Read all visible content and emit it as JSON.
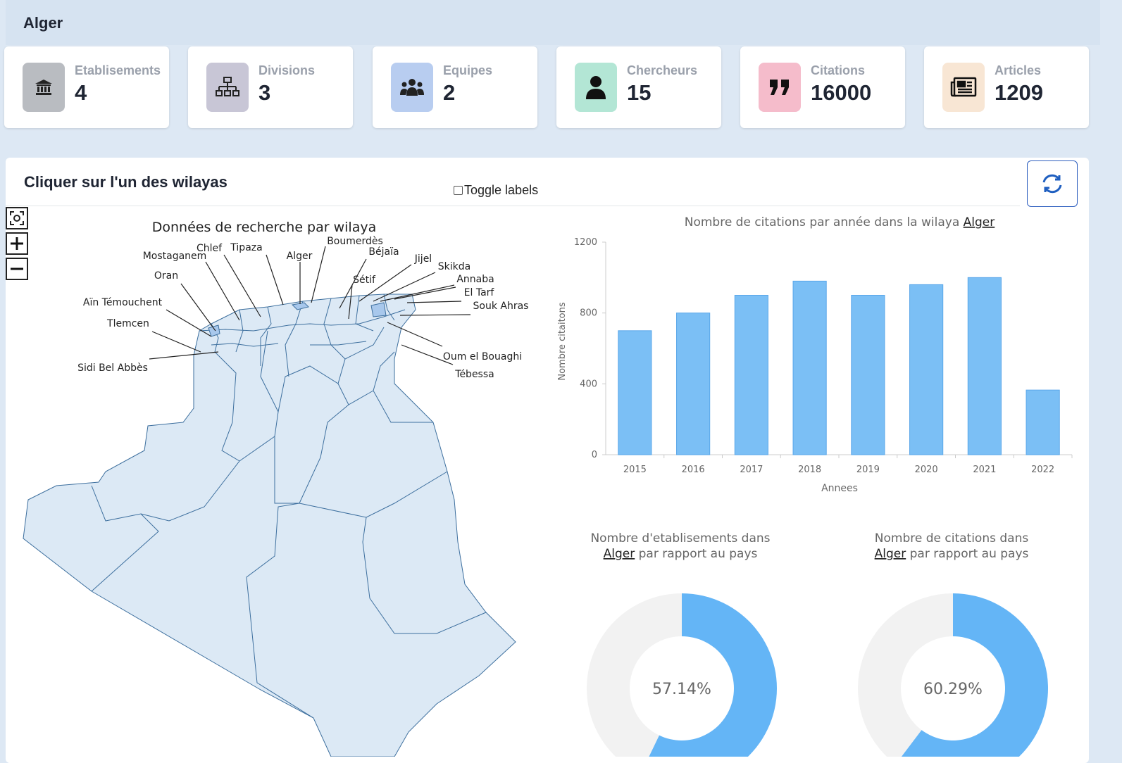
{
  "header": {
    "title": "Alger"
  },
  "stats": [
    {
      "label": "Etablisements",
      "value": "4",
      "icon": "bank-icon",
      "color": "#b9bcc1"
    },
    {
      "label": "Divisions",
      "value": "3",
      "icon": "hierarchy-icon",
      "color": "#c8c6d6"
    },
    {
      "label": "Equipes",
      "value": "2",
      "icon": "team-icon",
      "color": "#b8cdf0"
    },
    {
      "label": "Chercheurs",
      "value": "15",
      "icon": "user-icon",
      "color": "#b3e6d5"
    },
    {
      "label": "Citations",
      "value": "16000",
      "icon": "quote-icon",
      "color": "#f5bccb"
    },
    {
      "label": "Articles",
      "value": "1209",
      "icon": "newspaper-icon",
      "color": "#f8e6d4"
    }
  ],
  "panel": {
    "title": "Cliquer sur l'un des wilayas",
    "toggle_label": "Toggle labels"
  },
  "map": {
    "title": "Données de recherche par wilaya",
    "labels": [
      "Mostaganem",
      "Chlef",
      "Tipaza",
      "Alger",
      "Boumerdès",
      "Béjaïa",
      "Jijel",
      "Skikda",
      "Annaba",
      "El Tarf",
      "Souk Ahras",
      "Oran",
      "Aïn Témouchent",
      "Tlemcen",
      "Sidi Bel Abbès",
      "Sétif",
      "Oum el Bouaghi",
      "Tébessa"
    ]
  },
  "chart_data": [
    {
      "type": "bar",
      "title": "Nombre de citations par année dans la wilaya",
      "title_link": "Alger",
      "categories": [
        "2015",
        "2016",
        "2017",
        "2018",
        "2019",
        "2020",
        "2021",
        "2022"
      ],
      "values": [
        700,
        800,
        900,
        980,
        900,
        960,
        1000,
        365
      ],
      "xlabel": "Annees",
      "ylabel": "Nombre citaitons",
      "ylim": [
        0,
        1200
      ],
      "yticks": [
        0,
        400,
        800,
        1200
      ],
      "color": "#7bbff5"
    },
    {
      "type": "pie",
      "title_line1": "Nombre d'etablisements dans",
      "title_link": "Alger",
      "title_rest": "par rapport au pays",
      "percent": 57.14,
      "center_label": "57.14%",
      "color": "#64b5f6"
    },
    {
      "type": "pie",
      "title_line1": "Nombre de citations dans",
      "title_link": "Alger",
      "title_rest": "par rapport au pays",
      "percent": 60.29,
      "center_label": "60.29%",
      "color": "#64b5f6"
    }
  ]
}
